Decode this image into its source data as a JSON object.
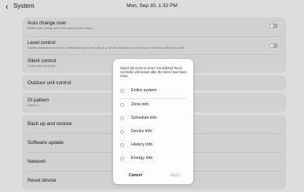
{
  "header": {
    "back_glyph": "‹",
    "title": "System",
    "datetime": "Mon, Sep 30, 1:32 PM"
  },
  "settings": {
    "auto_change_over": {
      "title": "Auto change over",
      "subtitle": "Enable Auto change over to be used on each device",
      "toggle_on": false
    },
    "level_control": {
      "title": "Level control",
      "subtitle": "Disable controllers lower than Centralized Touch Controller (e.g. On/off controllers) on the device in Remote control lock mode.",
      "toggle_on": false
    },
    "silent_control": {
      "title": "Silent control",
      "subtitle": "Control with no sound."
    },
    "outdoor_unit_control": {
      "title": "Outdoor unit control"
    },
    "di_pattern": {
      "title": "DI pattern",
      "subtitle": "Pattern 1"
    },
    "backup_restore": {
      "title": "Back up and restore"
    },
    "software_update": {
      "title": "Software update"
    },
    "network": {
      "title": "Network"
    },
    "reset_device": {
      "title": "Reset device"
    }
  },
  "dialog": {
    "message": "Select the items to reset. Centralized Touch Controller will restart after the items have been reset.",
    "options": [
      "Entire system",
      "Zone info",
      "Schedule info",
      "Device info",
      "History info",
      "Energy info"
    ],
    "cancel_label": "Cancel",
    "apply_label": "Apply"
  },
  "colors": {
    "background": "#f3f3f3",
    "card": "#e6e6e6",
    "dialog": "#fdfdfd",
    "disabled_text": "#b0b0b0"
  }
}
